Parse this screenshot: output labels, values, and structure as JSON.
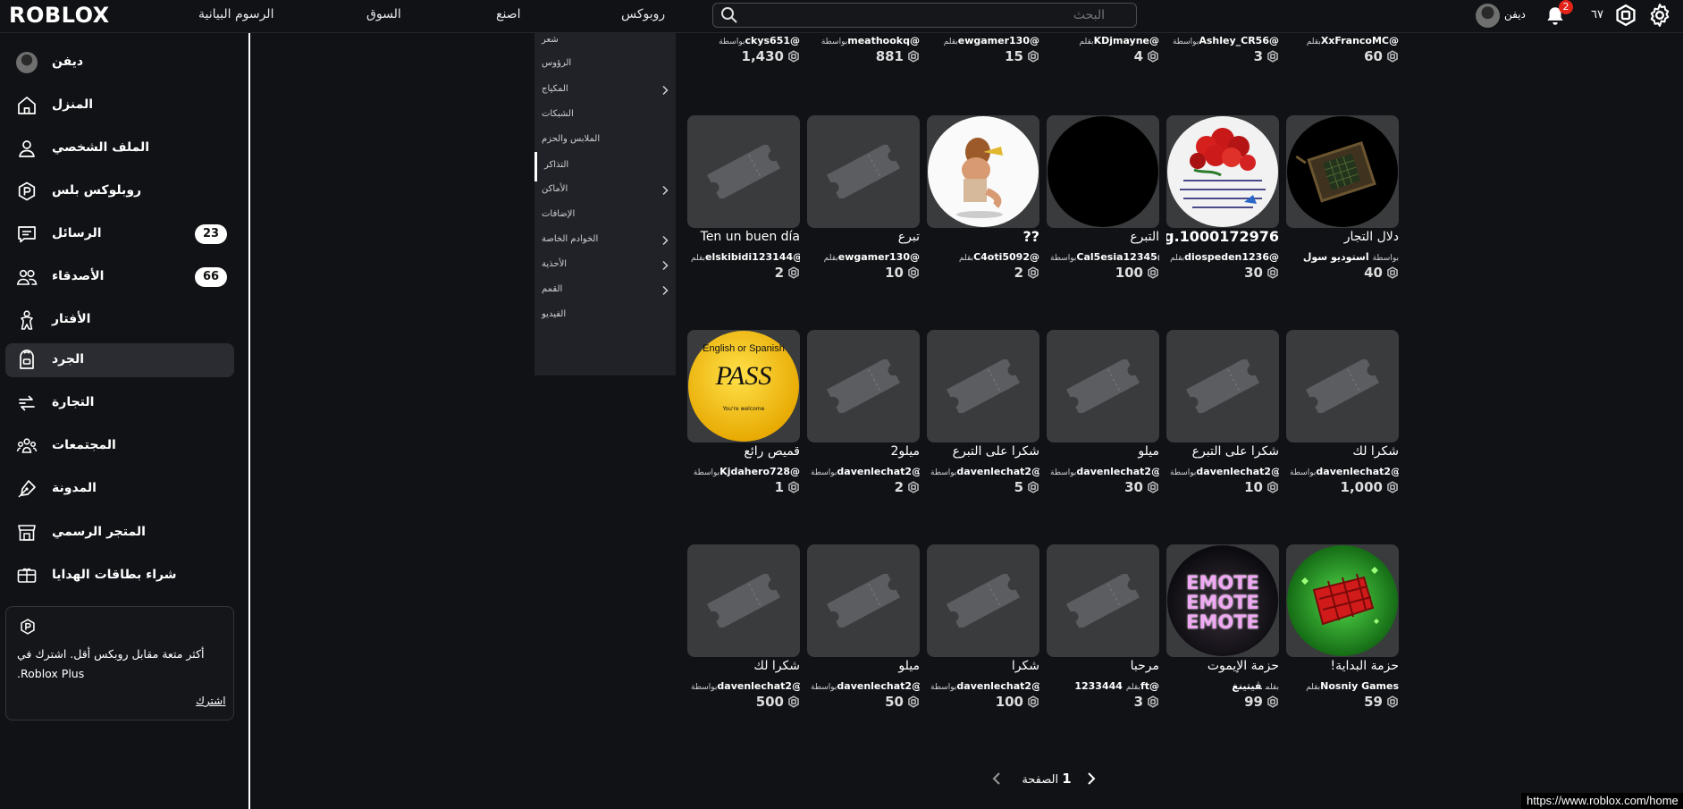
{
  "header": {
    "logo": "ROBLOX",
    "nav": [
      "الرسوم البيانية",
      "السوق",
      "اصنع",
      "روبوكس"
    ],
    "search_placeholder": "البحث",
    "username": "ديفن",
    "notifications": "2",
    "robux": "٦٧"
  },
  "sidebar": {
    "items": [
      {
        "label": "ديفن",
        "icon": "avatar"
      },
      {
        "label": "المنزل",
        "icon": "home-icon"
      },
      {
        "label": "الملف الشخصي",
        "icon": "profile-icon"
      },
      {
        "label": "روبلوكس بلس",
        "icon": "premium-icon"
      },
      {
        "label": "الرسائل",
        "icon": "messages-icon",
        "badge": "23"
      },
      {
        "label": "الأصدقاء",
        "icon": "friends-icon",
        "badge": "66"
      },
      {
        "label": "الأفتار",
        "icon": "avatar-icon"
      },
      {
        "label": "الجرد",
        "icon": "inventory-icon",
        "active": true
      },
      {
        "label": "التجارة",
        "icon": "trade-icon"
      },
      {
        "label": "المجتمعات",
        "icon": "communities-icon"
      },
      {
        "label": "المدونة",
        "icon": "blog-icon"
      },
      {
        "label": "المتجر الرسمي",
        "icon": "store-icon"
      },
      {
        "label": "شراء بطاقات الهدايا",
        "icon": "gift-card-icon"
      }
    ],
    "plus_card": {
      "text": "أكثر متعة مقابل روبكس أقل. اشترك في Roblox Plus.",
      "link": "اشترك"
    }
  },
  "dropdown": {
    "items": [
      {
        "label": "شعر",
        "chevron": false
      },
      {
        "label": "الرؤوس",
        "chevron": false
      },
      {
        "label": "المكياج",
        "chevron": true
      },
      {
        "label": "الشبكات",
        "chevron": false
      },
      {
        "label": "الملابس والحزم",
        "chevron": false
      },
      {
        "label": "التذاكر",
        "chevron": false,
        "active": true
      },
      {
        "label": "الأماكن",
        "chevron": true
      },
      {
        "label": "الإضافات",
        "chevron": false
      },
      {
        "label": "الخوادم الخاصة",
        "chevron": true
      },
      {
        "label": "الأحذية",
        "chevron": true
      },
      {
        "label": "القمم",
        "chevron": true
      },
      {
        "label": "الفيديو",
        "chevron": false
      }
    ]
  },
  "grid": {
    "row0": [
      {
        "by": "بقلم",
        "creator": "XxFrancoMC@",
        "price": "60"
      },
      {
        "by": "بواسطة",
        "creator": "Ashley_CR56@",
        "price": "3"
      },
      {
        "by": "بقلم",
        "creator": "KDjmayne@",
        "price": "4"
      },
      {
        "by": "بقلم",
        "creator": "ewgamer130@",
        "price": "15"
      },
      {
        "by": "بواسطة",
        "creator": "meathookq@",
        "price": "881"
      },
      {
        "by": "بواسطة",
        "creator": "ckys651@",
        "price": "1,430"
      }
    ],
    "row1": [
      {
        "name": "دلال التجار",
        "by": "بواسطة",
        "creator": "استوديو سول",
        "price": "40",
        "thumb": "device"
      },
      {
        "name": "1000172976.jpg",
        "by": "بقلم",
        "creator": "diospeden1236@",
        "price": "30",
        "thumb": "roses"
      },
      {
        "name": "التبرع",
        "by": "بواسطة",
        "creator": "Cal5esia12345@",
        "price": "100",
        "thumb": "black"
      },
      {
        "name": "??",
        "by": "بقلم",
        "creator": "C4oti5092@",
        "price": "2",
        "thumb": "figure"
      },
      {
        "name": "تبرع",
        "by": "بقلم",
        "creator": "ewgamer130@",
        "price": "10",
        "thumb": "ticket"
      },
      {
        "name": "Ten un buen día",
        "by": "بقلم",
        "creator": "elskibidi123144@",
        "price": "2",
        "thumb": "ticket"
      }
    ],
    "row2": [
      {
        "name": "شكرا لك",
        "by": "بواسطة",
        "creator": "davenlechat2@",
        "price": "1,000",
        "thumb": "ticket"
      },
      {
        "name": "شكرا على التبرع",
        "by": "بواسطة",
        "creator": "davenlechat2@",
        "price": "10",
        "thumb": "ticket"
      },
      {
        "name": "ميلو",
        "by": "بواسطة",
        "creator": "davenlechat2@",
        "price": "30",
        "thumb": "ticket"
      },
      {
        "name": "شكرا على التبرع",
        "by": "بواسطة",
        "creator": "davenlechat2@",
        "price": "5",
        "thumb": "ticket"
      },
      {
        "name": "ميلو2",
        "by": "بواسطة",
        "creator": "davenlechat2@",
        "price": "2",
        "thumb": "ticket"
      },
      {
        "name": "قميص رائع",
        "by": "بواسطة",
        "creator": "Kjdahero728@",
        "price": "1",
        "thumb": "pass"
      }
    ],
    "row3": [
      {
        "name": "حزمة البداية!",
        "by": "بقلم",
        "creator": "Nosniy Games",
        "price": "59",
        "thumb": "basket"
      },
      {
        "name": "حزمة الإيموت",
        "by": "بقلم",
        "creator": "ڤيتينغ",
        "price": "99",
        "thumb": "emote"
      },
      {
        "name": "مرحبا",
        "by": "بقلم",
        "creator": "1233444ft@",
        "price": "3",
        "thumb": "ticket"
      },
      {
        "name": "شكرا",
        "by": "بواسطة",
        "creator": "davenlechat2@",
        "price": "100",
        "thumb": "ticket"
      },
      {
        "name": "ميلو",
        "by": "بواسطة",
        "creator": "davenlechat2@",
        "price": "50",
        "thumb": "ticket"
      },
      {
        "name": "شكرا لك",
        "by": "بواسطة",
        "creator": "davenlechat2@",
        "price": "500",
        "thumb": "ticket"
      }
    ],
    "thumb_text": {
      "pass_top": "English or Spanish",
      "pass_main": "PASS",
      "pass_bottom": "You're welcome",
      "emote": "EMOTE"
    }
  },
  "pagination": {
    "label": "الصفحة",
    "page": "1"
  },
  "status_url": "https://www.roblox.com/home"
}
